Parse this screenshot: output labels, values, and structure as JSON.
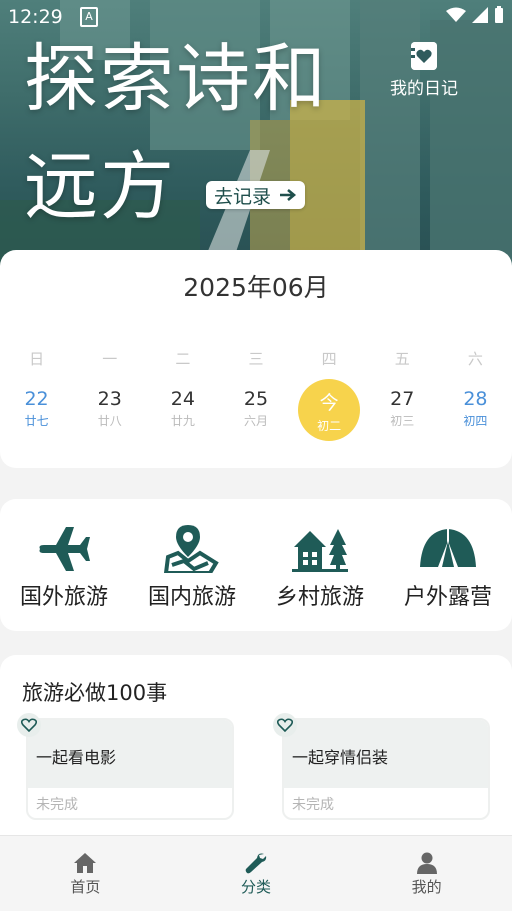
{
  "status_bar": {
    "time": "12:29",
    "notify_glyph": "A"
  },
  "hero": {
    "headline_line1": "探索诗和",
    "headline_line2": "远方",
    "diary_label": "我的日记",
    "record_label": "去记录"
  },
  "calendar": {
    "month_title": "2025年06月",
    "weekdays": [
      "日",
      "一",
      "二",
      "三",
      "四",
      "五",
      "六"
    ],
    "days": [
      {
        "num": "22",
        "lunar": "廿七",
        "weekend": true,
        "today": false
      },
      {
        "num": "23",
        "lunar": "廿八",
        "weekend": false,
        "today": false
      },
      {
        "num": "24",
        "lunar": "廿九",
        "weekend": false,
        "today": false
      },
      {
        "num": "25",
        "lunar": "六月",
        "weekend": false,
        "today": false
      },
      {
        "num": "今",
        "lunar": "初二",
        "weekend": false,
        "today": true
      },
      {
        "num": "27",
        "lunar": "初三",
        "weekend": false,
        "today": false
      },
      {
        "num": "28",
        "lunar": "初四",
        "weekend": true,
        "today": false
      }
    ],
    "today_color": "#f7d34c",
    "weekend_color": "#4a90d9"
  },
  "categories": [
    {
      "label": "国外旅游",
      "icon": "airplane-icon"
    },
    {
      "label": "国内旅游",
      "icon": "map-pin-icon"
    },
    {
      "label": "乡村旅游",
      "icon": "village-house-icon"
    },
    {
      "label": "户外露营",
      "icon": "tent-icon"
    }
  ],
  "bucket_list": {
    "title": "旅游必做100事",
    "items": [
      {
        "text": "一起看电影",
        "status": "未完成"
      },
      {
        "text": "一起穿情侣装",
        "status": "未完成"
      }
    ]
  },
  "tabs": [
    {
      "label": "首页",
      "icon": "home-icon",
      "active": false
    },
    {
      "label": "分类",
      "icon": "wrench-icon",
      "active": true
    },
    {
      "label": "我的",
      "icon": "user-icon",
      "active": false
    }
  ],
  "colors": {
    "brand": "#1f5b57",
    "hero_overlay": "#3f6d6b"
  }
}
